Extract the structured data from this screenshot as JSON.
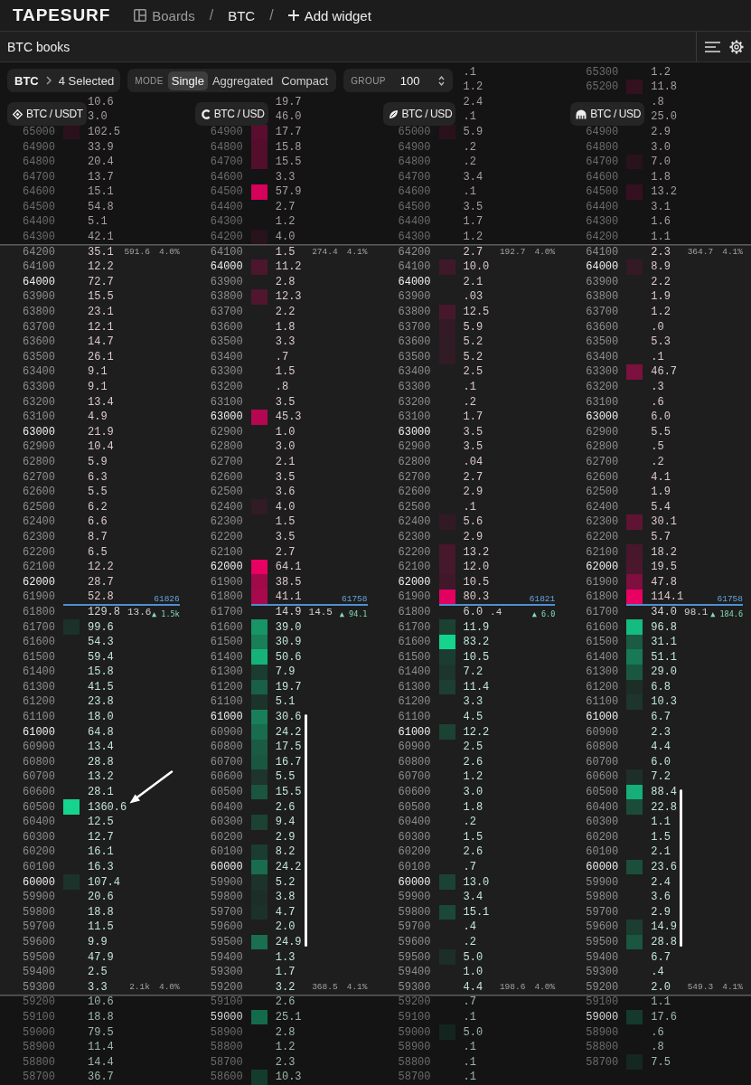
{
  "topbar": {
    "logo": "TAPESURF",
    "crumbs": [
      {
        "kind": "boards",
        "label": "Boards"
      },
      {
        "kind": "separator",
        "label": "/"
      },
      {
        "kind": "link",
        "label": "BTC"
      },
      {
        "kind": "separator",
        "label": "/"
      },
      {
        "kind": "add",
        "label": "Add widget"
      }
    ]
  },
  "panel": {
    "title": "BTC books"
  },
  "toolbar": {
    "symbol": "BTC",
    "selection": "4 Selected",
    "mode_label": "MODE",
    "modes": [
      {
        "label": "Single",
        "selected": true
      },
      {
        "label": "Aggregated",
        "selected": false
      },
      {
        "label": "Compact",
        "selected": false
      }
    ],
    "group_label": "GROUP",
    "group": "100"
  },
  "books": [
    {
      "kind": "diamond",
      "pair": "BTC / USDT",
      "upper": [
        {
          "size": "10.6"
        },
        {
          "size": "3.0"
        },
        {
          "price": "65000",
          "size": "102.5",
          "major": false
        },
        {
          "price": "64900",
          "size": "33.9",
          "major": false
        },
        {
          "price": "64800",
          "size": "20.4",
          "major": false
        },
        {
          "price": "64700",
          "size": "13.7",
          "major": false
        },
        {
          "price": "64600",
          "size": "15.1",
          "major": false
        },
        {
          "price": "64500",
          "size": "54.8",
          "major": false
        },
        {
          "price": "64400",
          "size": "5.1",
          "major": false
        },
        {
          "price": "64300",
          "size": "42.1",
          "major": false
        }
      ],
      "upper_total": "591.6",
      "upper_pct": "4.0%",
      "asks": [
        {
          "price": "64200",
          "size": "35.1",
          "major": false
        },
        {
          "price": "64100",
          "size": "12.2",
          "major": false
        },
        {
          "price": "64000",
          "size": "72.7",
          "major": true
        },
        {
          "price": "63900",
          "size": "15.5",
          "major": false
        },
        {
          "price": "63800",
          "size": "23.1",
          "major": false
        },
        {
          "price": "63700",
          "size": "12.1",
          "major": false
        },
        {
          "price": "63600",
          "size": "14.7",
          "major": false
        },
        {
          "price": "63500",
          "size": "26.1",
          "major": false
        },
        {
          "price": "63400",
          "size": "9.1",
          "major": false
        },
        {
          "price": "63300",
          "size": "9.1",
          "major": false
        },
        {
          "price": "63200",
          "size": "13.4",
          "major": false
        },
        {
          "price": "63100",
          "size": "4.9",
          "major": false
        },
        {
          "price": "63000",
          "size": "21.9",
          "major": true
        },
        {
          "price": "62900",
          "size": "10.4",
          "major": false
        },
        {
          "price": "62800",
          "size": "5.9",
          "major": false
        },
        {
          "price": "62700",
          "size": "6.3",
          "major": false
        },
        {
          "price": "62600",
          "size": "5.5",
          "major": false
        },
        {
          "price": "62500",
          "size": "6.2",
          "major": false
        },
        {
          "price": "62400",
          "size": "6.6",
          "major": false
        },
        {
          "price": "62300",
          "size": "8.7",
          "major": false
        },
        {
          "price": "62200",
          "size": "6.5",
          "major": false
        },
        {
          "price": "62100",
          "size": "12.2",
          "major": false
        },
        {
          "price": "62000",
          "size": "28.7",
          "major": true
        },
        {
          "price": "61900",
          "size": "52.8",
          "major": false
        }
      ],
      "mid": {
        "price": "61800",
        "size": "129.8",
        "traded": "13.6",
        "delta": "▲ 1.5k",
        "last": "61826"
      },
      "bids": [
        {
          "kind": "plain",
          "rows": [
            {
              "price": "61700",
              "size": "99.6",
              "major": false
            },
            {
              "price": "61600",
              "size": "54.3",
              "major": false
            },
            {
              "price": "61500",
              "size": "59.4",
              "major": false
            },
            {
              "price": "61400",
              "size": "15.8",
              "major": false
            },
            {
              "price": "61300",
              "size": "41.5",
              "major": false
            },
            {
              "price": "61200",
              "size": "23.8",
              "major": false
            },
            {
              "price": "61100",
              "size": "18.0",
              "major": false
            },
            {
              "price": "61000",
              "size": "64.8",
              "major": true
            },
            {
              "price": "60900",
              "size": "13.4",
              "major": false
            },
            {
              "price": "60800",
              "size": "28.8",
              "major": false
            },
            {
              "price": "60700",
              "size": "13.2",
              "major": false
            },
            {
              "price": "60600",
              "size": "28.1",
              "major": false
            }
          ]
        },
        {
          "kind": "arrow",
          "rows": [
            {
              "price": "60500",
              "size": "1360.6",
              "major": false
            }
          ]
        },
        {
          "kind": "plain",
          "rows": [
            {
              "price": "60400",
              "size": "12.5",
              "major": false
            },
            {
              "price": "60300",
              "size": "12.7",
              "major": false
            },
            {
              "price": "60200",
              "size": "16.1",
              "major": false
            },
            {
              "price": "60100",
              "size": "16.3",
              "major": false
            },
            {
              "price": "60000",
              "size": "107.4",
              "major": true
            },
            {
              "price": "59900",
              "size": "20.6",
              "major": false
            },
            {
              "price": "59800",
              "size": "18.8",
              "major": false
            },
            {
              "price": "59700",
              "size": "11.5",
              "major": false
            },
            {
              "price": "59600",
              "size": "9.9",
              "major": false
            },
            {
              "price": "59500",
              "size": "47.9",
              "major": false
            },
            {
              "price": "59400",
              "size": "2.5",
              "major": false
            },
            {
              "price": "59300",
              "size": "3.3",
              "major": false
            }
          ]
        }
      ],
      "lower_total": "2.1k",
      "lower_pct": "4.0%",
      "lower": [
        {
          "price": "59200",
          "size": "10.6",
          "major": false
        },
        {
          "price": "59100",
          "size": "18.8",
          "major": false
        },
        {
          "price": "59000",
          "size": "79.5",
          "major": false
        },
        {
          "price": "58900",
          "size": "11.4",
          "major": false
        },
        {
          "price": "58800",
          "size": "14.4",
          "major": false
        },
        {
          "price": "58700",
          "size": "36.7",
          "major": false
        }
      ]
    },
    {
      "kind": "crescent",
      "pair": "BTC / USD",
      "upper": [
        {
          "size": "19.7"
        },
        {
          "size": "46.0"
        },
        {
          "price": "64900",
          "size": "17.7",
          "major": false
        },
        {
          "price": "64800",
          "size": "15.8",
          "major": false
        },
        {
          "price": "64700",
          "size": "15.5",
          "major": false
        },
        {
          "price": "64600",
          "size": "3.3",
          "major": false
        },
        {
          "price": "64500",
          "size": "57.9",
          "major": false
        },
        {
          "price": "64400",
          "size": "2.7",
          "major": false
        },
        {
          "price": "64300",
          "size": "1.2",
          "major": false
        },
        {
          "price": "64200",
          "size": "4.0",
          "major": false
        }
      ],
      "upper_total": "274.4",
      "upper_pct": "4.1%",
      "asks": [
        {
          "price": "64100",
          "size": "1.5",
          "major": false
        },
        {
          "price": "64000",
          "size": "11.2",
          "major": true
        },
        {
          "price": "63900",
          "size": "2.8",
          "major": false
        },
        {
          "price": "63800",
          "size": "12.3",
          "major": false
        },
        {
          "price": "63700",
          "size": "2.2",
          "major": false
        },
        {
          "price": "63600",
          "size": "1.8",
          "major": false
        },
        {
          "price": "63500",
          "size": "3.3",
          "major": false
        },
        {
          "price": "63400",
          "size": ".7",
          "major": false
        },
        {
          "price": "63300",
          "size": "1.5",
          "major": false
        },
        {
          "price": "63200",
          "size": ".8",
          "major": false
        },
        {
          "price": "63100",
          "size": "3.5",
          "major": false
        },
        {
          "price": "63000",
          "size": "45.3",
          "major": true
        },
        {
          "price": "62900",
          "size": "1.0",
          "major": false
        },
        {
          "price": "62800",
          "size": "3.0",
          "major": false
        },
        {
          "price": "62700",
          "size": "2.1",
          "major": false
        },
        {
          "price": "62600",
          "size": "3.5",
          "major": false
        },
        {
          "price": "62500",
          "size": "3.6",
          "major": false
        },
        {
          "price": "62400",
          "size": "4.0",
          "major": false
        },
        {
          "price": "62300",
          "size": "1.5",
          "major": false
        },
        {
          "price": "62200",
          "size": "3.5",
          "major": false
        },
        {
          "price": "62100",
          "size": "2.7",
          "major": false
        },
        {
          "price": "62000",
          "size": "64.1",
          "major": true
        },
        {
          "price": "61900",
          "size": "38.5",
          "major": false
        },
        {
          "price": "61800",
          "size": "41.1",
          "major": false
        }
      ],
      "mid": {
        "price": "61700",
        "size": "14.9",
        "traded": "14.5",
        "delta": "▲ 94.1",
        "last": "61758"
      },
      "bids": [
        {
          "kind": "plain",
          "rows": [
            {
              "price": "61600",
              "size": "39.0",
              "major": false
            },
            {
              "price": "61500",
              "size": "30.9",
              "major": false
            },
            {
              "price": "61400",
              "size": "50.6",
              "major": false
            },
            {
              "price": "61300",
              "size": "7.9",
              "major": false
            },
            {
              "price": "61200",
              "size": "19.7",
              "major": false
            },
            {
              "price": "61100",
              "size": "5.1",
              "major": false
            }
          ]
        },
        {
          "kind": "bracket",
          "rows": [
            {
              "price": "61000",
              "size": "30.6",
              "major": true
            },
            {
              "price": "60900",
              "size": "24.2",
              "major": false
            },
            {
              "price": "60800",
              "size": "17.5",
              "major": false
            },
            {
              "price": "60700",
              "size": "16.7",
              "major": false
            },
            {
              "price": "60600",
              "size": "5.5",
              "major": false
            },
            {
              "price": "60500",
              "size": "15.5",
              "major": false
            },
            {
              "price": "60400",
              "size": "2.6",
              "major": false
            },
            {
              "price": "60300",
              "size": "9.4",
              "major": false
            },
            {
              "price": "60200",
              "size": "2.9",
              "major": false
            },
            {
              "price": "60100",
              "size": "8.2",
              "major": false
            },
            {
              "price": "60000",
              "size": "24.2",
              "major": true
            },
            {
              "price": "59900",
              "size": "5.2",
              "major": false
            },
            {
              "price": "59800",
              "size": "3.8",
              "major": false
            },
            {
              "price": "59700",
              "size": "4.7",
              "major": false
            },
            {
              "price": "59600",
              "size": "2.0",
              "major": false
            },
            {
              "price": "59500",
              "size": "24.9",
              "major": false
            }
          ]
        },
        {
          "kind": "plain",
          "rows": [
            {
              "price": "59400",
              "size": "1.3",
              "major": false
            },
            {
              "price": "59300",
              "size": "1.7",
              "major": false
            },
            {
              "price": "59200",
              "size": "3.2",
              "major": false
            }
          ]
        }
      ],
      "lower_total": "368.5",
      "lower_pct": "4.1%",
      "lower": [
        {
          "price": "59100",
          "size": "2.6",
          "major": false
        },
        {
          "price": "59000",
          "size": "25.1",
          "major": true
        },
        {
          "price": "58900",
          "size": "2.8",
          "major": false
        },
        {
          "price": "58800",
          "size": "1.2",
          "major": false
        },
        {
          "price": "58700",
          "size": "2.3",
          "major": false
        },
        {
          "price": "58600",
          "size": "10.3",
          "major": false
        }
      ]
    },
    {
      "kind": "leaf",
      "pair": "BTC / USD",
      "upper": [
        {
          "size": ".1"
        },
        {
          "size": "1.2"
        },
        {
          "size": "2.4"
        },
        {
          "size": ".1"
        },
        {
          "price": "65000",
          "size": "5.9",
          "major": false
        },
        {
          "price": "64900",
          "size": ".2",
          "major": false
        },
        {
          "price": "64800",
          "size": ".2",
          "major": false
        },
        {
          "price": "64700",
          "size": "3.4",
          "major": false
        },
        {
          "price": "64600",
          "size": ".1",
          "major": false
        },
        {
          "price": "64500",
          "size": "3.5",
          "major": false
        },
        {
          "price": "64400",
          "size": "1.7",
          "major": false
        },
        {
          "price": "64300",
          "size": "1.2",
          "major": false
        }
      ],
      "upper_total": "192.7",
      "upper_pct": "4.0%",
      "asks": [
        {
          "price": "64200",
          "size": "2.7",
          "major": false
        },
        {
          "price": "64100",
          "size": "10.0",
          "major": false
        },
        {
          "price": "64000",
          "size": "2.1",
          "major": true
        },
        {
          "price": "63900",
          "size": ".03",
          "major": false
        },
        {
          "price": "63800",
          "size": "12.5",
          "major": false
        },
        {
          "price": "63700",
          "size": "5.9",
          "major": false
        },
        {
          "price": "63600",
          "size": "5.2",
          "major": false
        },
        {
          "price": "63500",
          "size": "5.2",
          "major": false
        },
        {
          "price": "63400",
          "size": "2.5",
          "major": false
        },
        {
          "price": "63300",
          "size": ".1",
          "major": false
        },
        {
          "price": "63200",
          "size": ".2",
          "major": false
        },
        {
          "price": "63100",
          "size": "1.7",
          "major": false
        },
        {
          "price": "63000",
          "size": "3.5",
          "major": true
        },
        {
          "price": "62900",
          "size": "3.5",
          "major": false
        },
        {
          "price": "62800",
          "size": ".04",
          "major": false
        },
        {
          "price": "62700",
          "size": "2.7",
          "major": false
        },
        {
          "price": "62600",
          "size": "2.9",
          "major": false
        },
        {
          "price": "62500",
          "size": ".1",
          "major": false
        },
        {
          "price": "62400",
          "size": "5.6",
          "major": false
        },
        {
          "price": "62300",
          "size": "2.9",
          "major": false
        },
        {
          "price": "62200",
          "size": "13.2",
          "major": false
        },
        {
          "price": "62100",
          "size": "12.0",
          "major": false
        },
        {
          "price": "62000",
          "size": "10.5",
          "major": true
        },
        {
          "price": "61900",
          "size": "80.3",
          "major": false
        }
      ],
      "mid": {
        "price": "61800",
        "size": "6.0",
        "traded": ".4",
        "delta": "▲ 6.0",
        "last": "61821"
      },
      "bids": [
        {
          "kind": "plain",
          "rows": [
            {
              "price": "61700",
              "size": "11.9",
              "major": false
            },
            {
              "price": "61600",
              "size": "83.2",
              "major": false
            },
            {
              "price": "61500",
              "size": "10.5",
              "major": false
            },
            {
              "price": "61400",
              "size": "7.2",
              "major": false
            },
            {
              "price": "61300",
              "size": "11.4",
              "major": false
            },
            {
              "price": "61200",
              "size": "3.3",
              "major": false
            },
            {
              "price": "61100",
              "size": "4.5",
              "major": false
            },
            {
              "price": "61000",
              "size": "12.2",
              "major": true
            },
            {
              "price": "60900",
              "size": "2.5",
              "major": false
            },
            {
              "price": "60800",
              "size": "2.6",
              "major": false
            },
            {
              "price": "60700",
              "size": "1.2",
              "major": false
            },
            {
              "price": "60600",
              "size": "3.0",
              "major": false
            },
            {
              "price": "60500",
              "size": "1.8",
              "major": false
            },
            {
              "price": "60400",
              "size": ".2",
              "major": false
            },
            {
              "price": "60300",
              "size": "1.5",
              "major": false
            },
            {
              "price": "60200",
              "size": "2.6",
              "major": false
            },
            {
              "price": "60100",
              "size": ".7",
              "major": false
            },
            {
              "price": "60000",
              "size": "13.0",
              "major": true
            },
            {
              "price": "59900",
              "size": "3.4",
              "major": false
            },
            {
              "price": "59800",
              "size": "15.1",
              "major": false
            },
            {
              "price": "59700",
              "size": ".4",
              "major": false
            },
            {
              "price": "59600",
              "size": ".2",
              "major": false
            },
            {
              "price": "59500",
              "size": "5.0",
              "major": false
            },
            {
              "price": "59400",
              "size": "1.0",
              "major": false
            },
            {
              "price": "59300",
              "size": "4.4",
              "major": false
            }
          ]
        }
      ],
      "lower_total": "198.6",
      "lower_pct": "4.0%",
      "lower": [
        {
          "price": "59200",
          "size": ".7",
          "major": false
        },
        {
          "price": "59100",
          "size": ".1",
          "major": false
        },
        {
          "price": "59000",
          "size": "5.0",
          "major": false
        },
        {
          "price": "58900",
          "size": ".1",
          "major": false
        },
        {
          "price": "58800",
          "size": ".1",
          "major": false
        },
        {
          "price": "58700",
          "size": ".1",
          "major": false
        }
      ]
    },
    {
      "kind": "dome",
      "pair": "BTC / USD",
      "upper": [
        {
          "price": "65300",
          "size": "1.2",
          "major": false
        },
        {
          "price": "65200",
          "size": "11.8",
          "major": false
        },
        {
          "size": ".8"
        },
        {
          "size": "25.0"
        },
        {
          "price": "64900",
          "size": "2.9",
          "major": false
        },
        {
          "price": "64800",
          "size": "3.0",
          "major": false
        },
        {
          "price": "64700",
          "size": "7.0",
          "major": false
        },
        {
          "price": "64600",
          "size": "1.8",
          "major": false
        },
        {
          "price": "64500",
          "size": "13.2",
          "major": false
        },
        {
          "price": "64400",
          "size": "3.1",
          "major": false
        },
        {
          "price": "64300",
          "size": "1.6",
          "major": false
        },
        {
          "price": "64200",
          "size": "1.1",
          "major": false
        }
      ],
      "upper_total": "364.7",
      "upper_pct": "4.1%",
      "asks": [
        {
          "price": "64100",
          "size": "2.3",
          "major": false
        },
        {
          "price": "64000",
          "size": "8.9",
          "major": true
        },
        {
          "price": "63900",
          "size": "2.2",
          "major": false
        },
        {
          "price": "63800",
          "size": "1.9",
          "major": false
        },
        {
          "price": "63700",
          "size": "1.2",
          "major": false
        },
        {
          "price": "63600",
          "size": ".0",
          "major": false
        },
        {
          "price": "63500",
          "size": "5.3",
          "major": false
        },
        {
          "price": "63400",
          "size": ".1",
          "major": false
        },
        {
          "price": "63300",
          "size": "46.7",
          "major": false
        },
        {
          "price": "63200",
          "size": ".3",
          "major": false
        },
        {
          "price": "63100",
          "size": ".6",
          "major": false
        },
        {
          "price": "63000",
          "size": "6.0",
          "major": true
        },
        {
          "price": "62900",
          "size": "5.5",
          "major": false
        },
        {
          "price": "62800",
          "size": ".5",
          "major": false
        },
        {
          "price": "62700",
          "size": ".2",
          "major": false
        },
        {
          "price": "62600",
          "size": "4.1",
          "major": false
        },
        {
          "price": "62500",
          "size": "1.9",
          "major": false
        },
        {
          "price": "62400",
          "size": "5.4",
          "major": false
        },
        {
          "price": "62300",
          "size": "30.1",
          "major": false
        },
        {
          "price": "62200",
          "size": "5.7",
          "major": false
        },
        {
          "price": "62100",
          "size": "18.2",
          "major": false
        },
        {
          "price": "62000",
          "size": "19.5",
          "major": true
        },
        {
          "price": "61900",
          "size": "47.8",
          "major": false
        },
        {
          "price": "61800",
          "size": "114.1",
          "major": false
        }
      ],
      "mid": {
        "price": "61700",
        "size": "34.0",
        "traded": "98.1",
        "delta": "▲ 184.6",
        "last": "61758"
      },
      "bids": [
        {
          "kind": "plain",
          "rows": [
            {
              "price": "61600",
              "size": "96.8",
              "major": false
            },
            {
              "price": "61500",
              "size": "31.1",
              "major": false
            },
            {
              "price": "61400",
              "size": "51.1",
              "major": false
            },
            {
              "price": "61300",
              "size": "29.0",
              "major": false
            },
            {
              "price": "61200",
              "size": "6.8",
              "major": false
            },
            {
              "price": "61100",
              "size": "10.3",
              "major": false
            },
            {
              "price": "61000",
              "size": "6.7",
              "major": true
            },
            {
              "price": "60900",
              "size": "2.3",
              "major": false
            },
            {
              "price": "60800",
              "size": "4.4",
              "major": false
            },
            {
              "price": "60700",
              "size": "6.0",
              "major": false
            },
            {
              "price": "60600",
              "size": "7.2",
              "major": false
            }
          ]
        },
        {
          "kind": "bracket",
          "rows": [
            {
              "price": "60500",
              "size": "88.4",
              "major": false
            },
            {
              "price": "60400",
              "size": "22.8",
              "major": false
            },
            {
              "price": "60300",
              "size": "1.1",
              "major": false
            },
            {
              "price": "60200",
              "size": "1.5",
              "major": false
            },
            {
              "price": "60100",
              "size": "2.1",
              "major": false
            },
            {
              "price": "60000",
              "size": "23.6",
              "major": true
            },
            {
              "price": "59900",
              "size": "2.4",
              "major": false
            },
            {
              "price": "59800",
              "size": "3.6",
              "major": false
            },
            {
              "price": "59700",
              "size": "2.9",
              "major": false
            },
            {
              "price": "59600",
              "size": "14.9",
              "major": false
            },
            {
              "price": "59500",
              "size": "28.8",
              "major": false
            }
          ]
        },
        {
          "kind": "plain",
          "rows": [
            {
              "price": "59400",
              "size": "6.7",
              "major": false
            },
            {
              "price": "59300",
              "size": ".4",
              "major": false
            },
            {
              "price": "59200",
              "size": "2.0",
              "major": false
            }
          ]
        }
      ],
      "lower_total": "549.3",
      "lower_pct": "4.1%",
      "lower": [
        {
          "price": "59100",
          "size": "1.1",
          "major": false
        },
        {
          "price": "59000",
          "size": "17.6",
          "major": true
        },
        {
          "price": "58900",
          "size": ".6",
          "major": false
        },
        {
          "price": "58800",
          "size": ".8",
          "major": false
        },
        {
          "price": "58700",
          "size": "7.5",
          "major": false
        }
      ]
    }
  ]
}
